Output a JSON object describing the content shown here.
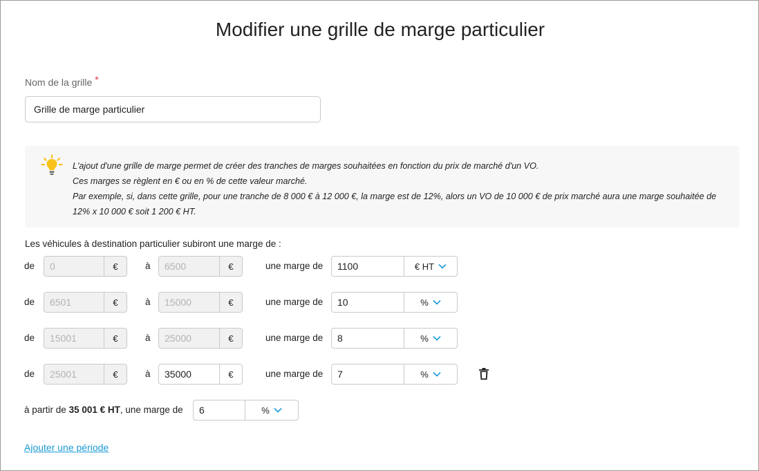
{
  "page": {
    "title": "Modifier une grille de marge particulier"
  },
  "name_field": {
    "label": "Nom de la grille",
    "required_mark": "*",
    "value": "Grille de marge particulier"
  },
  "info": {
    "icon": "lightbulb-icon",
    "icon_color": "#f9c21b",
    "lines": [
      "L'ajout d'une grille de marge permet de créer des tranches de marges souhaitées en fonction du prix de marché d'un VO.",
      "Ces marges se règlent en € ou en % de cette valeur marché.",
      "Par exemple, si, dans cette grille, pour une tranche de 8 000 € à 12 000 €, la marge est de 12%, alors un VO de 10 000 € de prix marché aura une marge souhaitée de",
      "12% x 10 000 € soit 1 200 € HT."
    ]
  },
  "grid": {
    "intro": "Les véhicules à destination particulier subiront une marge de :",
    "from_label": "de",
    "to_label": "à",
    "margin_label": "une marge de",
    "currency": "€",
    "rows": [
      {
        "from": "0",
        "to": "6500",
        "margin": "1100",
        "unit": "€ HT"
      },
      {
        "from": "6501",
        "to": "15000",
        "margin": "10",
        "unit": "%"
      },
      {
        "from": "15001",
        "to": "25000",
        "margin": "8",
        "unit": "%"
      },
      {
        "from": "25001",
        "to": "35000",
        "margin": "7",
        "unit": "%"
      }
    ]
  },
  "final": {
    "prefix": "à partir de",
    "amount": "35 001 € HT",
    "suffix": ", une marge de",
    "margin": "6",
    "unit": "%"
  },
  "add_period_link": "Ajouter une période",
  "colors": {
    "accent": "#1a9ad6",
    "required": "#e0303a",
    "info_bg": "#f7f7f7"
  }
}
